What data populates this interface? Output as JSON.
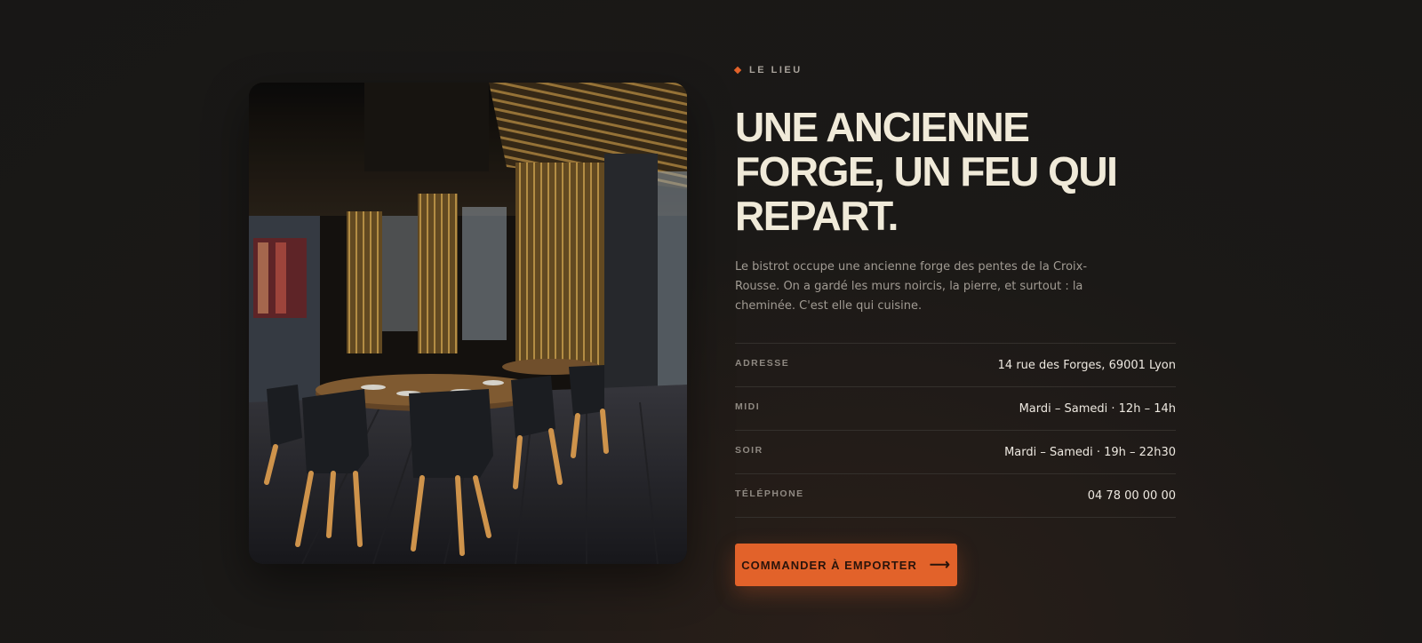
{
  "section": {
    "eyebrow": "LE LIEU",
    "headline": "UNE ANCIENNE FORGE, UN FEU QUI REPART.",
    "lead": "Le bistrot occupe une ancienne forge des pentes de la Croix-Rousse. On a gardé les murs noircis, la pierre, et surtout : la cheminée. C'est elle qui cuisine."
  },
  "info": [
    {
      "label": "ADRESSE",
      "value": "14 rue des Forges, 69001 Lyon"
    },
    {
      "label": "MIDI",
      "value": "Mardi – Samedi · 12h – 14h"
    },
    {
      "label": "SOIR",
      "value": "Mardi – Samedi · 19h – 22h30"
    },
    {
      "label": "TÉLÉPHONE",
      "value": "04 78 00 00 00"
    }
  ],
  "cta": {
    "label": "COMMANDER À EMPORTER",
    "icon": "arrow-right-icon"
  },
  "colors": {
    "accent": "#e2622a",
    "background": "#1b1917",
    "text": "#f0ead9"
  },
  "image": {
    "subject": "restaurant-interior-photo"
  }
}
